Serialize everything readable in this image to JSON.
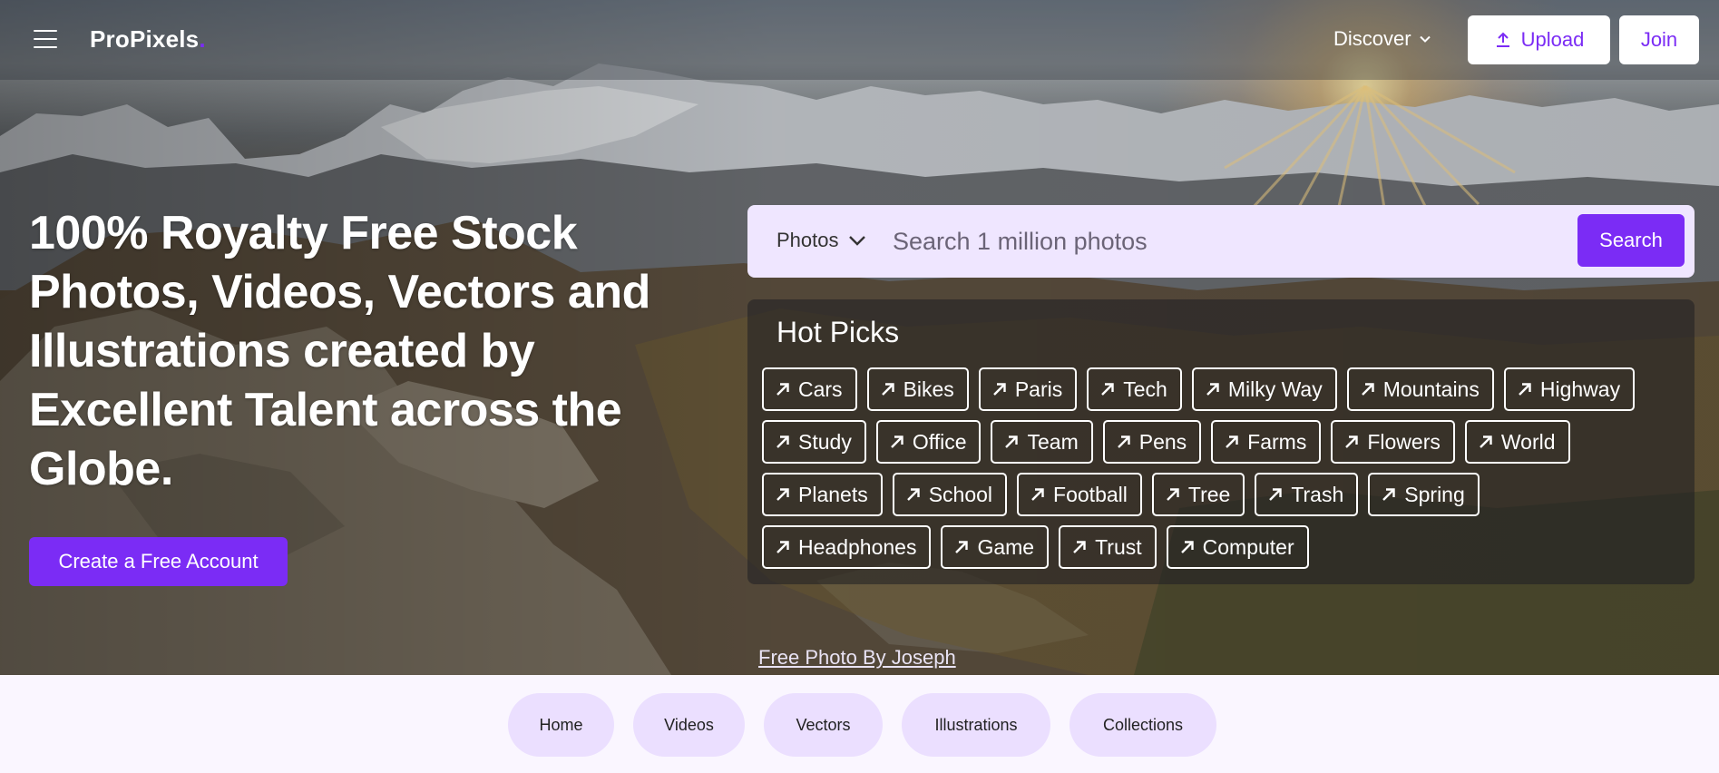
{
  "header": {
    "logo_text": "ProPixels",
    "logo_dot": ".",
    "discover_label": "Discover",
    "upload_label": "Upload",
    "join_label": "Join"
  },
  "hero": {
    "headline": "100% Royalty Free Stock Photos, Videos, Vectors and Illustrations created by Excellent Talent across the Globe.",
    "cta_label": "Create a Free Account",
    "photo_credit": "Free Photo By Joseph"
  },
  "search": {
    "type_label": "Photos",
    "placeholder": "Search 1 million photos",
    "button_label": "Search"
  },
  "hot_picks": {
    "title": "Hot Picks",
    "rows": [
      [
        "Cars",
        "Bikes",
        "Paris",
        "Tech",
        "Milky Way",
        "Mountains",
        "Highway"
      ],
      [
        "Study",
        "Office",
        "Team",
        "Pens",
        "Farms",
        "Flowers",
        "World"
      ],
      [
        "Planets",
        "School",
        "Football",
        "Tree",
        "Trash",
        "Spring"
      ],
      [
        "Headphones",
        "Game",
        "Trust",
        "Computer"
      ]
    ]
  },
  "bottom_nav": {
    "items": [
      "Home",
      "Videos",
      "Vectors",
      "Illustrations",
      "Collections"
    ]
  },
  "colors": {
    "accent": "#7b2cf5",
    "search_bg": "#efe6ff",
    "pill_bg": "#ebdfff",
    "page_bg": "#faf6ff"
  },
  "icons": {
    "menu": "hamburger-icon",
    "discover": "chevron-down-icon",
    "upload": "upload-icon",
    "tag": "arrow-up-right-icon"
  }
}
